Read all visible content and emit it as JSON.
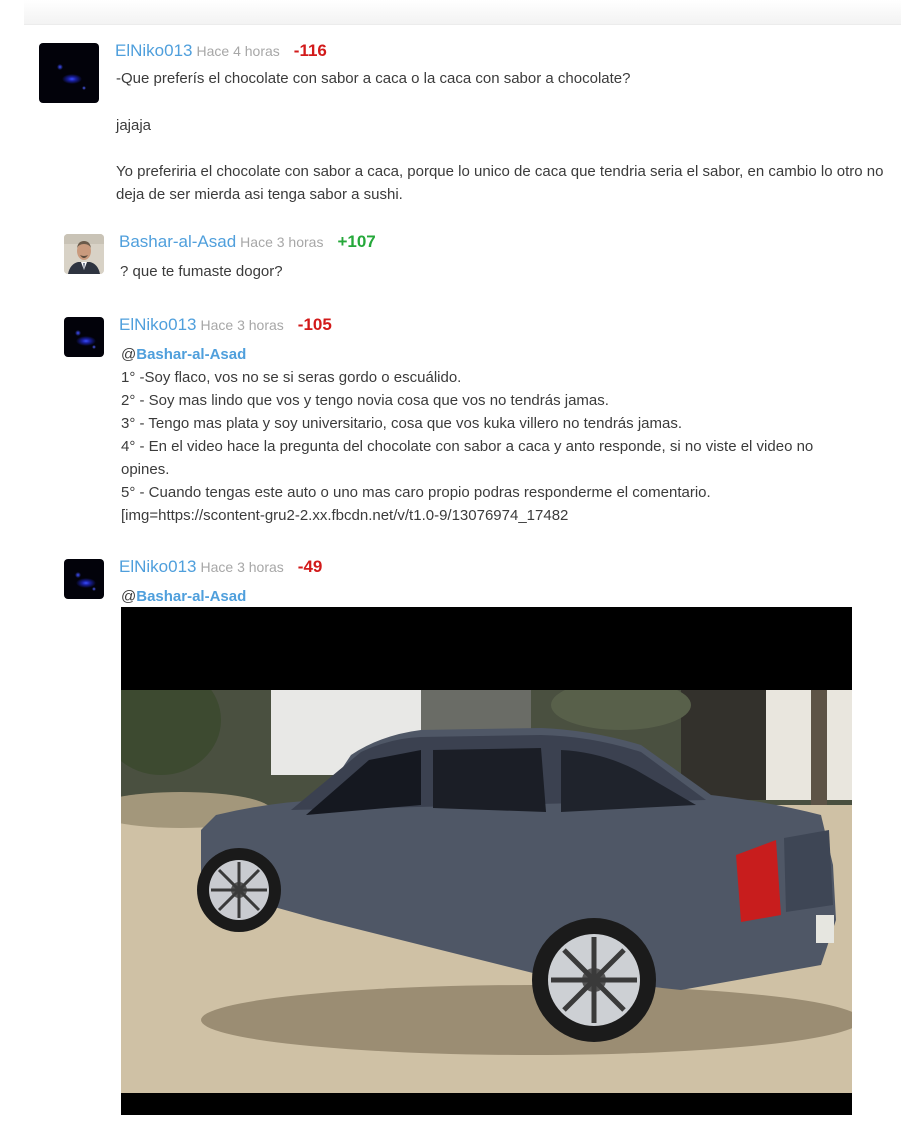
{
  "comments": [
    {
      "username": "ElNiko013",
      "time": "Hace 4 horas",
      "score": "-116",
      "paragraphs": [
        "-Que preferís el chocolate con sabor a caca o la caca con sabor a chocolate?",
        "jajaja",
        "Yo preferiria el chocolate con sabor a caca, porque lo unico de caca que tendria seria el sabor, en cambio lo otro no deja de ser mierda asi tenga sabor a sushi."
      ]
    },
    {
      "username": "Bashar-al-Asad",
      "time": "Hace 3 horas",
      "score": "+107",
      "text": "? que te fumaste dogor?"
    },
    {
      "username": "ElNiko013",
      "time": "Hace 3 horas",
      "score": "-105",
      "mention_prefix": "@",
      "mention": "Bashar-al-Asad",
      "lines": [
        "1° -Soy flaco, vos no se si seras gordo o escuálido.",
        "2° - Soy mas lindo que vos y tengo novia cosa que vos no tendrás jamas.",
        "3° - Tengo mas plata y soy universitario, cosa que vos kuka villero no tendrás jamas.",
        "4° - En el video hace la pregunta del chocolate con sabor a caca y anto responde, si no viste el video no opines.",
        "5° - Cuando tengas este auto o uno mas caro propio podras responderme el comentario.",
        "[img=https://scontent-gru2-2.xx.fbcdn.net/v/t1.0-9/13076974_17482"
      ]
    },
    {
      "username": "ElNiko013",
      "time": "Hace 3 horas",
      "score": "-49",
      "mention_prefix": "@",
      "mention": "Bashar-al-Asad"
    }
  ],
  "colors": {
    "username": "#4f9fdc",
    "negative_score": "#d21a1a",
    "positive_score": "#25a83a",
    "timestamp": "#a7a7a7"
  }
}
